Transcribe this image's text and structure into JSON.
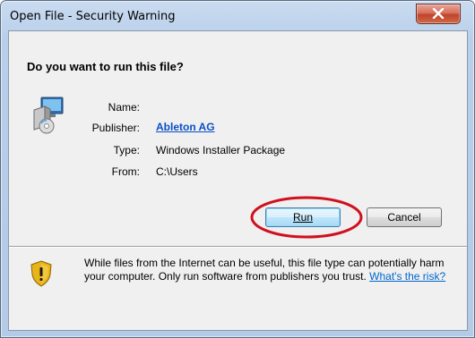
{
  "window": {
    "title": "Open File - Security Warning",
    "close_label": "close"
  },
  "dialog": {
    "heading": "Do you want to run this file?",
    "fields": {
      "name_label": "Name:",
      "name_value": "",
      "publisher_label": "Publisher:",
      "publisher_value": "Ableton AG",
      "type_label": "Type:",
      "type_value": "Windows Installer Package",
      "from_label": "From:",
      "from_value": "C:\\Users"
    },
    "buttons": {
      "run_label": "Run",
      "cancel_label": "Cancel"
    },
    "footer": {
      "text": "While files from the Internet can be useful, this file type can potentially harm your computer. Only run software from publishers you trust.",
      "link": "What's the risk?"
    }
  },
  "icons": {
    "file": "installer-package-icon",
    "warning": "security-shield-icon",
    "close": "close-icon"
  },
  "colors": {
    "link": "#0066cc",
    "publisher_link": "#0b4fc4",
    "annotation": "#d0101e",
    "close_button": "#c0432b"
  }
}
